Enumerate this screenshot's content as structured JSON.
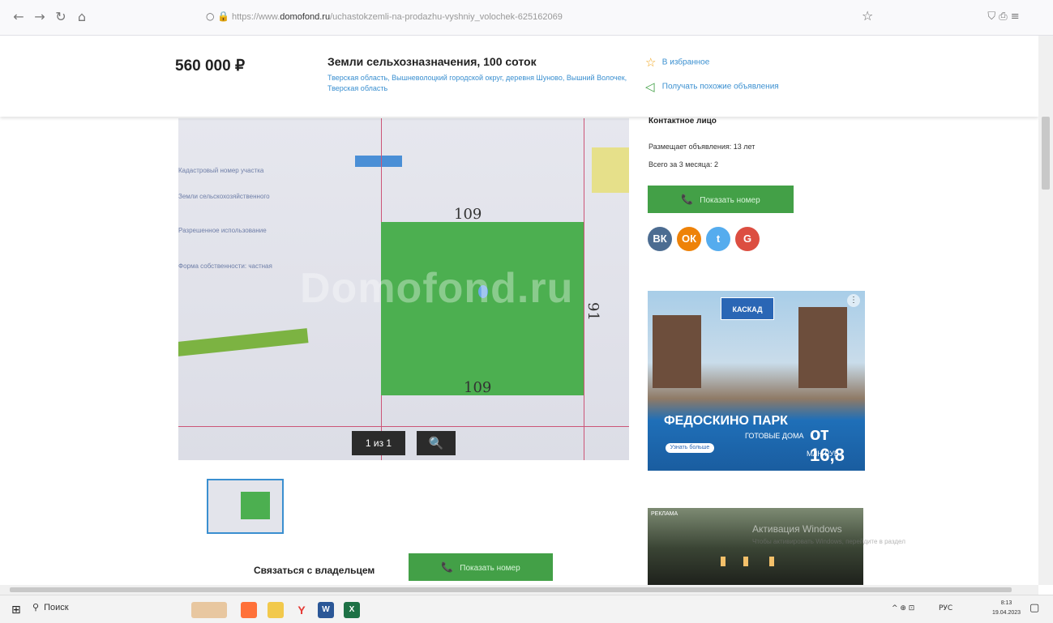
{
  "browser": {
    "url_prefix": "https://www.",
    "url_domain": "domofond.ru",
    "url_path": "/uchastokzemli-na-prodazhu-vyshniy_volochek-625162069",
    "back_icon": "←",
    "forward_icon": "→",
    "reload_icon": "↻",
    "home_icon": "⌂",
    "lock_icon": "○ 🔒",
    "star_icon": "☆",
    "right_icons": "⛉  ⎙  ≡"
  },
  "listing": {
    "price": "560 000 ₽",
    "title": "Земли сельхозназначения, 100 соток",
    "address": "Тверская область, Вышневолоцкий городской округ, деревня Шуново, Вышний Волочек, Тверская область"
  },
  "actions": {
    "favorite_icon": "☆",
    "favorite_label": "В избранное",
    "similar_icon": "◁",
    "similar_label": "Получать похожие объявления"
  },
  "photo": {
    "watermark": "Domofond.ru",
    "hand_top": "109",
    "hand_bottom": "109",
    "hand_right": "91",
    "counter": "1 из 1",
    "zoom_icon": "🔍"
  },
  "contact": {
    "heading": "Контактное лицо",
    "posting_since": "Размещает объявления: 13 лет",
    "total_3_months": "Всего за 3 месяца: 2",
    "show_phone": "Показать номер",
    "phone_icon": "📞",
    "contact_owner": "Связаться с владельцем"
  },
  "social": {
    "vk": "ВК",
    "ok": "ОК",
    "twitter": "t",
    "google": "G",
    "colors": {
      "vk": "#4c6c91",
      "ok": "#ee8208",
      "twitter": "#55acee",
      "google": "#dc4e41"
    }
  },
  "ad1": {
    "logo": "КАСКАД",
    "headline": "ФЕДОСКИНО ПАРК",
    "sub": "ГОТОВЫЕ ДОМА",
    "price": "от 16,8",
    "price_unit": "МЛН РУБ.",
    "button": "Узнать больше"
  },
  "ad2": {
    "tag": "РЕКЛАМА"
  },
  "windows": {
    "activation_title": "Активация Windows",
    "activation_sub": "Чтобы активировать Windows, перейдите в раздел"
  },
  "taskbar": {
    "start_icon": "⊞",
    "search_icon": "⚲",
    "search_label": "Поиск",
    "apps": [
      "🦊",
      "📁",
      "Y",
      "W",
      "X"
    ],
    "tray_icons": "^ ⊕ ⊡",
    "lang": "РУС",
    "time": "8:13",
    "date": "19.04.2023",
    "notification_icon": "▢"
  },
  "colors": {
    "accent_blue": "#3a8fd0",
    "button_green": "#43a047",
    "plot_green": "#4caf50"
  }
}
